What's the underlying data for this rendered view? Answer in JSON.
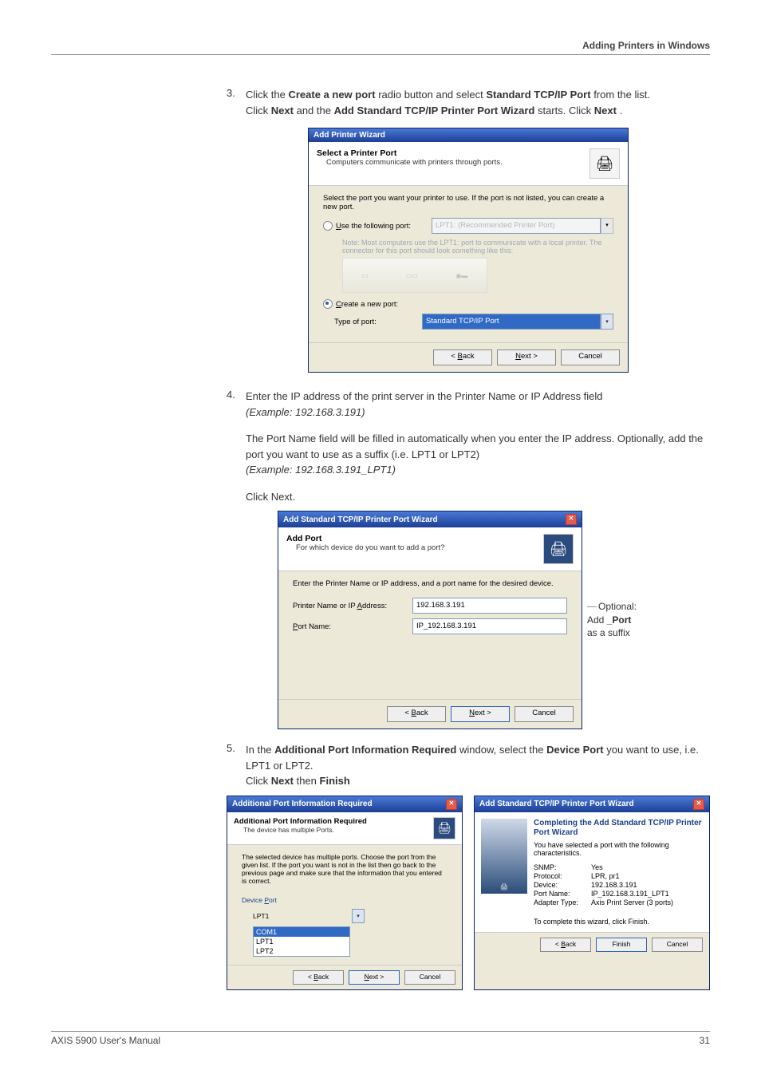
{
  "header": {
    "section": "Adding Printers in Windows"
  },
  "step3": {
    "num": "3.",
    "text_a": "Click the ",
    "bold_a": "Create a new port",
    "text_b": " radio button and select ",
    "bold_b": "Standard TCP/IP Port",
    "text_c": " from the list.",
    "line2_a": "Click ",
    "line2_bold_a": "Next",
    "line2_b": " and the ",
    "line2_bold_b": "Add Standard TCP/IP Printer Port Wizard",
    "line2_c": " starts. Click ",
    "line2_bold_c": "Next",
    "line2_d": "."
  },
  "dialog1": {
    "title": "Add Printer Wizard",
    "h_main": "Select a Printer Port",
    "h_sub": "Computers communicate with printers through ports.",
    "body_top": "Select the port you want your printer to use.  If the port is not listed, you can create a new port.",
    "use_following_port": "Use the following port:",
    "use_port_value": "LPT1: (Recommended Printer Port)",
    "note": "Note: Most computers use the LPT1: port to communicate with a local printer. The connector for this port should look something like this:",
    "create_new_port": "Create a new port:",
    "type_of_port": "Type of port:",
    "type_value": "Standard TCP/IP Port",
    "back": "< Back",
    "next": "Next >",
    "cancel": "Cancel",
    "imgicon": "🖨"
  },
  "step4": {
    "num": "4.",
    "line1": "Enter the IP address of the print server in the Printer Name or IP Address field",
    "example1": "(Example: 192.168.3.191)",
    "para2": "The Port Name field will be filled in automatically when you enter the IP address. Optionally, add the port you want to use as a suffix (i.e. LPT1 or LPT2)",
    "example2": "(Example: 192.168.3.191_LPT1)",
    "clicknext": "Click Next."
  },
  "dialog2": {
    "title": "Add Standard TCP/IP Printer Port Wizard",
    "h_main": "Add Port",
    "h_sub": "For which device do you want to add a port?",
    "body_top": "Enter the Printer Name or IP address, and a port name for the desired device.",
    "field1": "Printer Name or IP Address:",
    "field1_val": "192.168.3.191",
    "field2": "Port Name:",
    "field2_val": "IP_192.168.3.191",
    "back": "< Back",
    "next": "Next >",
    "cancel": "Cancel",
    "printericon": "🖨"
  },
  "annotation": {
    "l1": "Optional:",
    "l2_a": "Add ",
    "l2_b": "_Port",
    "l3": "as a suffix"
  },
  "step5": {
    "num": "5.",
    "text_a": "In the ",
    "bold_a": "Additional Port Information Required",
    "text_b": " window, select the ",
    "bold_b": "Device Port",
    "text_c": " you want to use, i.e. LPT1 or LPT2.",
    "line2_a": "Click ",
    "line2_bold_a": "Next",
    "line2_b": " then ",
    "line2_bold_b": "Finish"
  },
  "dialog3": {
    "title": "Additional Port Information Required",
    "h_main": "Additional Port Information Required",
    "h_sub": "The device has multiple Ports.",
    "body": "The selected device has multiple ports.  Choose the port from the given list.  If the port you want is not in the list then go back to the previous page and make sure that the information that you entered is correct.",
    "device_port": "Device Port",
    "opts": [
      "LPT1",
      "COM1",
      "LPT1",
      "LPT2"
    ],
    "back": "< Back",
    "next": "Next >",
    "cancel": "Cancel",
    "printericon": "🖨"
  },
  "dialog4": {
    "title": "Add Standard TCP/IP Printer Port Wizard",
    "comp_h": "Completing the Add Standard TCP/IP Printer Port Wizard",
    "comp_sub": "You have selected a port with the following characteristics.",
    "kv": {
      "SNMP:": "Yes",
      "Protocol:": "LPR, pr1",
      "Device:": "192.168.3.191",
      "Port Name:": "IP_192.168.3.191_LPT1",
      "Adapter Type:": "Axis Print Server (3 ports)"
    },
    "complete": "To complete this wizard, click Finish.",
    "back": "< Back",
    "finish": "Finish",
    "cancel": "Cancel"
  },
  "footer": {
    "left": "AXIS 5900 User's Manual",
    "right": "31"
  }
}
